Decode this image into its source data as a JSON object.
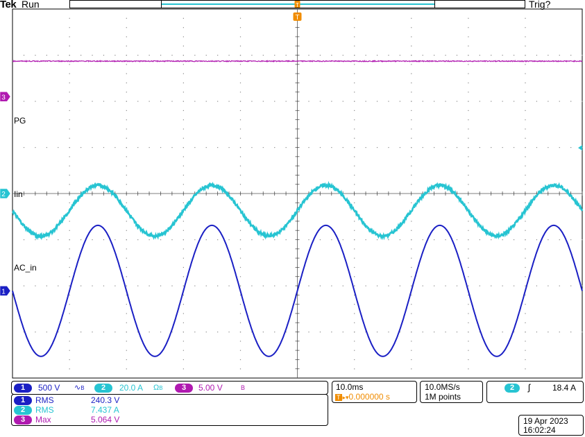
{
  "header": {
    "brand": "Tek",
    "state": "Run",
    "trigger_status": "Trig?",
    "trigger_marker": "T"
  },
  "colors": {
    "ch1": "#1a1fc4",
    "ch2": "#27c4d2",
    "ch3": "#b01ab0",
    "trigger": "#f08c00",
    "grid": "#888888"
  },
  "channels": [
    {
      "num": "1",
      "label": "AC_in",
      "scale": "500 V",
      "coupling_icon": "bandwidth-limit-icon"
    },
    {
      "num": "2",
      "label": "Iin",
      "scale": "20.0 A",
      "coupling_icon": "bandwidth-limit-icon"
    },
    {
      "num": "3",
      "label": "PG",
      "scale": "5.00 V",
      "coupling_icon": "bandwidth-limit-icon"
    }
  ],
  "measurements": [
    {
      "num": "1",
      "type": "RMS",
      "value": "240.3 V"
    },
    {
      "num": "2",
      "type": "RMS",
      "value": "7.437 A"
    },
    {
      "num": "3",
      "type": "Max",
      "value": "5.064 V"
    }
  ],
  "horizontal": {
    "time_per_div": "10.0ms",
    "trigger_position": "0.000000 s"
  },
  "acquisition": {
    "sample_rate": "10.0MS/s",
    "record_length": "1M points"
  },
  "trigger": {
    "source": "2",
    "slope": "rising",
    "level": "18.4 A"
  },
  "datetime": {
    "date": "19 Apr  2023",
    "time": "16:02:24"
  },
  "chart_data": {
    "type": "line",
    "grid": true,
    "x_divisions": 10,
    "y_divisions": 8,
    "x_unit": "ms",
    "x_range": [
      -50,
      50
    ],
    "series": [
      {
        "name": "AC_in",
        "channel": 1,
        "waveform": "sine",
        "frequency_hz": 50,
        "amplitude_div": 1.42,
        "offset_div": -2.11,
        "phase_at_trigger_deg": 0,
        "noise": 0
      },
      {
        "name": "Iin",
        "channel": 2,
        "waveform": "sine",
        "frequency_hz": 50,
        "amplitude_div": 0.55,
        "offset_div": -0.37,
        "phase_at_trigger_deg": 0,
        "noise": 0.03
      },
      {
        "name": "PG",
        "channel": 3,
        "waveform": "dc",
        "level_div": 2.87,
        "noise": 0.01
      }
    ],
    "markers": {
      "ch1_ground_div": -2.11,
      "ch2_ground_div": 0,
      "ch3_ground_div": 2.1,
      "trigger_level_div": 0.99
    }
  }
}
